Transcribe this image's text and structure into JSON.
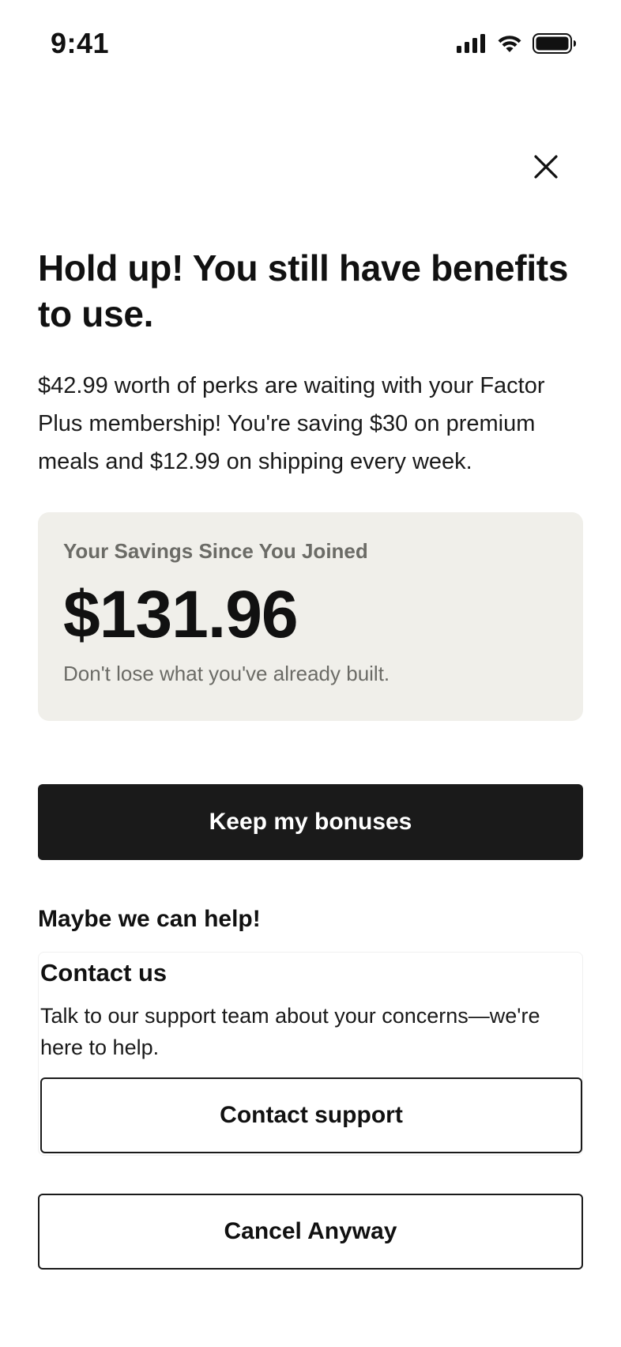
{
  "status_bar": {
    "time": "9:41",
    "icons": [
      "cellular-signal-icon",
      "wifi-icon",
      "battery-icon"
    ]
  },
  "header": {
    "close_icon": "close-icon"
  },
  "main": {
    "headline": "Hold up! You still have benefits to use.",
    "description": "$42.99 worth of perks are waiting with your Factor Plus membership! You're saving $30 on premium meals and $12.99 on shipping every week.",
    "savings": {
      "label": "Your Savings Since You Joined",
      "amount": "$131.96",
      "subtext": "Don't lose what you've already built."
    },
    "primary_button_label": "Keep my bonuses",
    "help_heading": "Maybe we can help!",
    "contact": {
      "title": "Contact us",
      "description": "Talk to our support team about your concerns—we're here to help.",
      "button_label": "Contact support"
    },
    "cancel_button_label": "Cancel Anyway"
  },
  "colors": {
    "primary_button_bg": "#1a1a1a",
    "card_bg": "#f0efea",
    "muted_text": "#6b6b66"
  }
}
